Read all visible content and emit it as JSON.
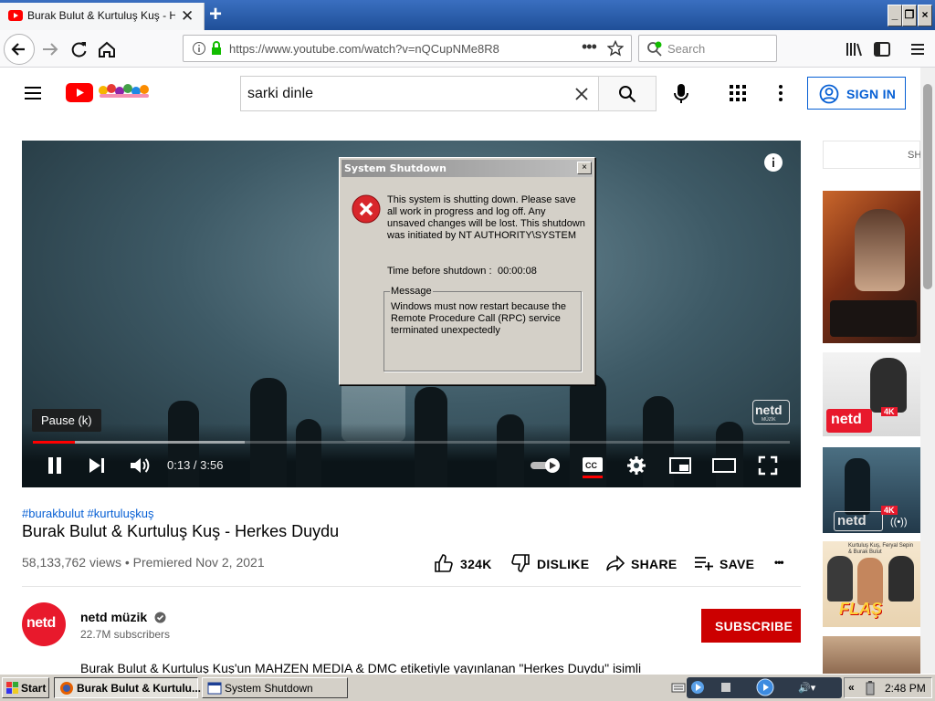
{
  "browser": {
    "tab_title": "Burak Bulut & Kurtuluş Kuş - Herkes Duydu",
    "url": "https://www.youtube.com/watch?v=nQCupNMe8R8",
    "search_placeholder": "Search"
  },
  "youtube": {
    "search_query": "sarki dinle",
    "signin_label": "SIGN IN",
    "side_top_label": "SH"
  },
  "player": {
    "tooltip": "Pause (k)",
    "time_display": "0:13 / 3:56",
    "played_fraction": 0.055,
    "buffered_fraction": 0.28,
    "watermark_text": "netd",
    "watermark_sub": "MÜZİK"
  },
  "dialog": {
    "title": "System Shutdown",
    "close": "×",
    "message": "This system is shutting down. Please save all work in progress and log off. Any unsaved changes will be lost. This shutdown was initiated by NT AUTHORITY\\SYSTEM",
    "time_label": "Time before shutdown :",
    "time_value": "00:00:08",
    "group_label": "Message",
    "group_message": "Windows must now restart because the Remote Procedure Call (RPC) service terminated unexpectedly"
  },
  "video": {
    "hashtags": "#burakbulut #kurtuluşkuş",
    "title": "Burak Bulut & Kurtuluş Kuş - Herkes Duydu",
    "views": "58,133,762 views • Premiered Nov 2, 2021",
    "likes": "324K",
    "dislike_label": "DISLIKE",
    "share_label": "SHARE",
    "save_label": "SAVE",
    "more_label": "•••"
  },
  "channel": {
    "avatar_text": "netd",
    "name": "netd müzik",
    "subscribers": "22.7M subscribers",
    "subscribe_label": "SUBSCRIBE",
    "description": "Burak Bulut & Kurtuluş Kuş'un  MAHZEN MEDIA & DMC etiketiyle yayınlanan \"Herkes Duydu\" isimli"
  },
  "thumbnails": {
    "badge": "4K",
    "netd": "netd",
    "flas": "FLAŞ",
    "flas_caption": "Kurtuluş Kuş, Feryal Sepin & Burak Bulut"
  },
  "taskbar": {
    "start_label": "Start",
    "task1": "Burak Bulut & Kurtulu...",
    "task2": "System Shutdown",
    "clock": "2:48 PM"
  },
  "colors": {
    "yt_red": "#ff0000",
    "link_blue": "#065fd4",
    "subscribe_red": "#cc0000",
    "win_face": "#d4d0c8"
  }
}
